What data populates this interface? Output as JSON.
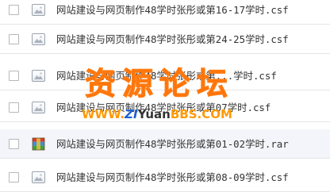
{
  "files": [
    {
      "name": "网站建设与网页制作48学时张彤或第16-17学时.csf",
      "type": "csf"
    },
    {
      "name": "网站建设与网页制作48学时张彤或第24-25学时.csf",
      "type": "csf"
    },
    {
      "name": "网站建设与网页制作48学时张彤或第...学时.csf",
      "type": "csf"
    },
    {
      "name": "网站建设与网页制作48学时张彤或第07学时.csf",
      "type": "csf"
    },
    {
      "name": "网站建设与网页制作48学时张彤或第01-02学时.rar",
      "type": "rar"
    },
    {
      "name": "网站建设与网页制作48学时张彤或第08-09学时.csf",
      "type": "csf"
    }
  ],
  "watermark": {
    "title": "资源论坛",
    "url_www": "WWW.",
    "url_zi": "ZI",
    "url_yuan": "Yuan",
    "url_bbs": "BBS",
    "url_com": ".COM"
  },
  "colors": {
    "watermark_orange": "#ff6a00",
    "watermark_blue": "#1e5fd6",
    "row_highlight": "#f3f5fa"
  }
}
